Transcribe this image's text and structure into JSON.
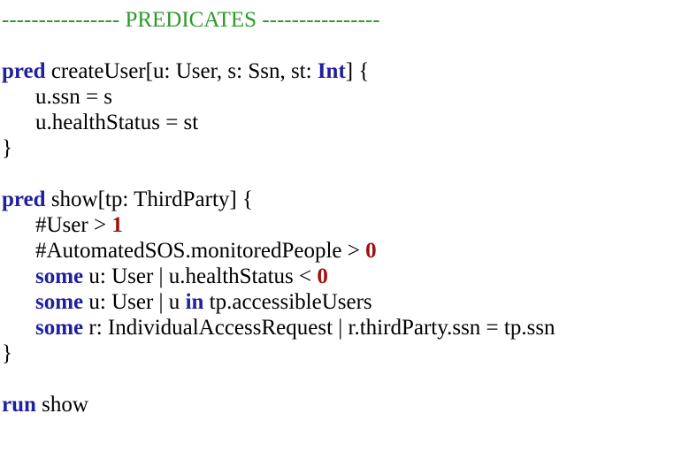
{
  "colors": {
    "keyword": "#1f1fa0",
    "number": "#a01010",
    "comment": "#2a9a2a",
    "text": "#000000"
  },
  "code": {
    "header": "---------------- PREDICATES ----------------",
    "pred1": {
      "kw": "pred",
      "sig_a": " createUser[u: User, s: Ssn, st: ",
      "int_kw": "Int",
      "sig_b": "] {",
      "body1": "u.ssn = s",
      "body2": "u.healthStatus = st",
      "close": "}"
    },
    "pred2": {
      "kw": "pred",
      "sig": " show[tp: ThirdParty] {",
      "l1_text": "#User > ",
      "l1_num": "1",
      "l2_text": "#AutomatedSOS.monitoredPeople > ",
      "l2_num": "0",
      "l3_kw": "some",
      "l3_text": " u: User | u.healthStatus < ",
      "l3_num": "0",
      "l4_kw": "some",
      "l4_text_a": " u: User | u ",
      "l4_in": "in",
      "l4_text_b": " tp.accessibleUsers",
      "l5_kw": "some",
      "l5_text": " r: IndividualAccessRequest | r.thirdParty.ssn = tp.ssn",
      "close": "}"
    },
    "run": {
      "kw": "run",
      "text": " show"
    }
  }
}
